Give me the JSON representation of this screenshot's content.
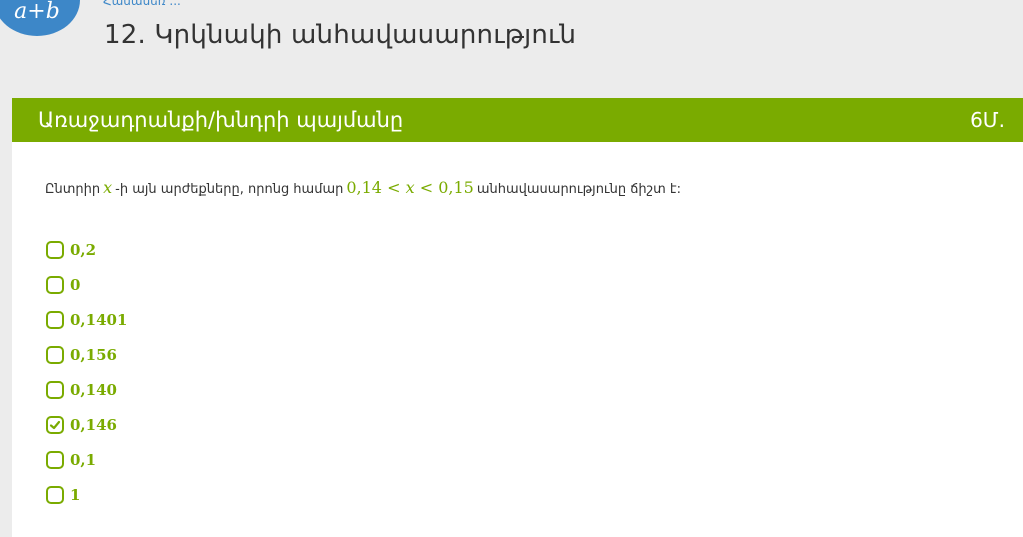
{
  "header": {
    "logo_text": "a+b",
    "breadcrumb": "Համասեռ ...",
    "title": "12. Կրկնակի անհավասարություն"
  },
  "task": {
    "title": "Առաջադրանքի/խնդրի պայմանը",
    "points": "6Մ.",
    "question": {
      "part1": "Ընտրիր ",
      "var1": "x",
      "part2": "-ի այն արժեքները, որոնց համար ",
      "math_a": "0,14",
      "lt1": "<",
      "var2": "x",
      "lt2": "<",
      "math_b": "0,15",
      "part3": " անհավասարությունը ճիշտ է:"
    },
    "options": [
      {
        "label": "0,2",
        "checked": false
      },
      {
        "label": "0",
        "checked": false
      },
      {
        "label": "0,1401",
        "checked": false
      },
      {
        "label": "0,156",
        "checked": false
      },
      {
        "label": "0,140",
        "checked": false
      },
      {
        "label": "0,146",
        "checked": true
      },
      {
        "label": "0,1",
        "checked": false
      },
      {
        "label": "1",
        "checked": false
      }
    ]
  },
  "colors": {
    "accent_green": "#7aab00",
    "brand_blue": "#3d87c8",
    "background": "#ececec"
  }
}
